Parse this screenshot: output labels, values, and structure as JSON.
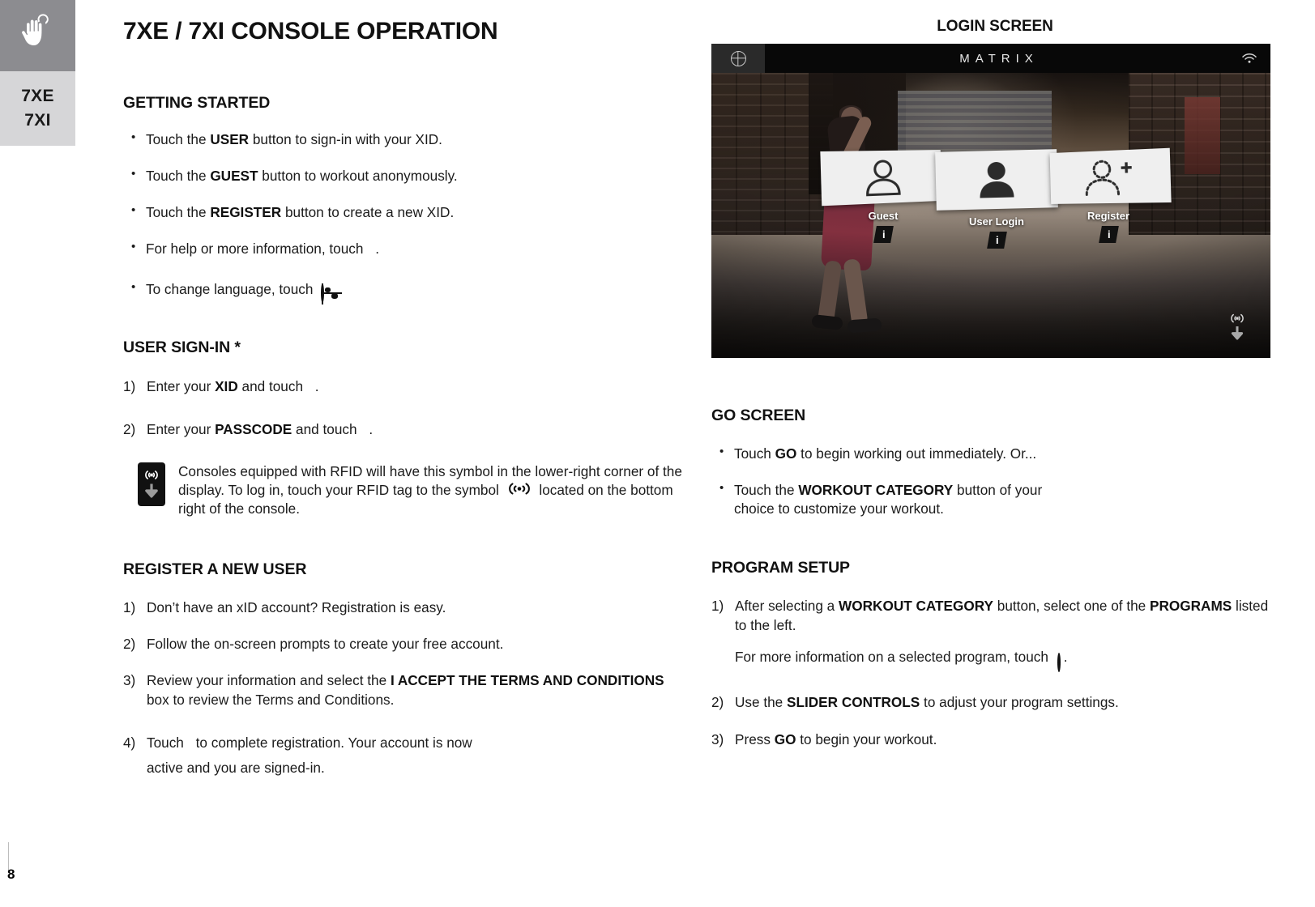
{
  "sidebar": {
    "icon": "hand-touch-icon",
    "labels": [
      "7XE",
      "7XI"
    ]
  },
  "page_number": "8",
  "title": "7XE / 7XI CONSOLE OPERATION",
  "left_column": {
    "getting_started": {
      "heading": "GETTING STARTED",
      "bullets": [
        {
          "pre": "Touch the ",
          "bold": "USER",
          "post": " button to sign-in with your XID.",
          "icon": null
        },
        {
          "pre": "Touch the ",
          "bold": "GUEST",
          "post": " button to workout anonymously.",
          "icon": null
        },
        {
          "pre": "Touch the ",
          "bold": "REGISTER",
          "post": " button to create a new XID.",
          "icon": null
        },
        {
          "pre": "For help or more information, touch ",
          "bold": "",
          "post": " .",
          "icon": "info-slant-icon"
        },
        {
          "pre": "To change language, touch ",
          "bold": "",
          "post": " .",
          "icon": "globe-icon"
        }
      ]
    },
    "user_signin": {
      "heading": "USER SIGN-IN *",
      "items": [
        {
          "num": "1)",
          "pre": "Enter your ",
          "bold": "XID",
          "post": " and touch ",
          "icon": "check-icon",
          "tail": "."
        },
        {
          "num": "2)",
          "pre": "Enter your ",
          "bold": "PASSCODE",
          "post": " and touch ",
          "icon": "check-icon",
          "tail": "."
        }
      ],
      "rfid_note": {
        "badge_icon": "rfid-download-icon",
        "text_part1": "Consoles equipped with RFID will have this symbol in the lower-right corner of the display. To log in, touch your RFID tag to the symbol ",
        "inline_icon": "rfid-icon",
        "text_part2": " located on the bottom right of the console."
      }
    },
    "register": {
      "heading": "REGISTER A NEW USER",
      "items": [
        {
          "num": "1)",
          "pre": "Don’t have an xID account? Registration is easy.",
          "bold": "",
          "post": "",
          "icon": null,
          "tail": ""
        },
        {
          "num": "2)",
          "pre": "Follow the on-screen prompts to create your free account.",
          "bold": "",
          "post": "",
          "icon": null,
          "tail": ""
        },
        {
          "num": "3)",
          "pre": "Review your information and select the ",
          "bold": "I ACCEPT THE TERMS AND CONDITIONS",
          "post": " box to review the Terms and Conditions.",
          "icon": null,
          "tail": ""
        },
        {
          "num": "4)",
          "pre": "Touch ",
          "bold": "",
          "post": " to complete registration. Your account is now active and you are signed-in.",
          "icon": "check-icon",
          "tail": ""
        }
      ]
    }
  },
  "right_column": {
    "screen_caption": "LOGIN SCREEN",
    "console": {
      "brand": "MATRIX",
      "globe_icon": "globe-icon",
      "wifi_icon": "wifi-icon",
      "rfid_icon": "rfid-download-icon",
      "cards": [
        {
          "label": "Guest",
          "icon": "person-outline-icon",
          "info": "i"
        },
        {
          "label": "User Login",
          "icon": "person-filled-icon",
          "info": "i"
        },
        {
          "label": "Register",
          "icon": "person-add-dotted-icon",
          "info": "i"
        }
      ]
    },
    "go_screen": {
      "heading": "GO SCREEN",
      "bullets": [
        {
          "pre": "Touch ",
          "bold": "GO",
          "post": " to begin working out immediately. Or...",
          "icon": null
        },
        {
          "pre": "Touch the ",
          "bold": "WORKOUT CATEGORY",
          "post": " button of your choice to customize your workout.",
          "icon": null
        }
      ]
    },
    "program_setup": {
      "heading": "PROGRAM SETUP",
      "items": [
        {
          "num": "1)",
          "pre": "After selecting a ",
          "bold": "WORKOUT CATEGORY",
          "post": " button, select one of the ",
          "bold2": "PROGRAMS",
          "post2": " listed to the left.",
          "sub_pre": "For more information on a selected program, touch ",
          "sub_icon": "info-circle-icon",
          "sub_post": " ."
        },
        {
          "num": "2)",
          "pre": "Use the ",
          "bold": "SLIDER CONTROLS",
          "post": " to adjust your program settings."
        },
        {
          "num": "3)",
          "pre": "Press ",
          "bold": "GO",
          "post": " to begin your workout."
        }
      ]
    }
  },
  "colors": {
    "sidebar_icon_bg": "#8c8c90",
    "sidebar_label_bg": "#d6d6d8",
    "text": "#1b1b1b",
    "heading": "#111111",
    "console_bar": "#080808"
  }
}
